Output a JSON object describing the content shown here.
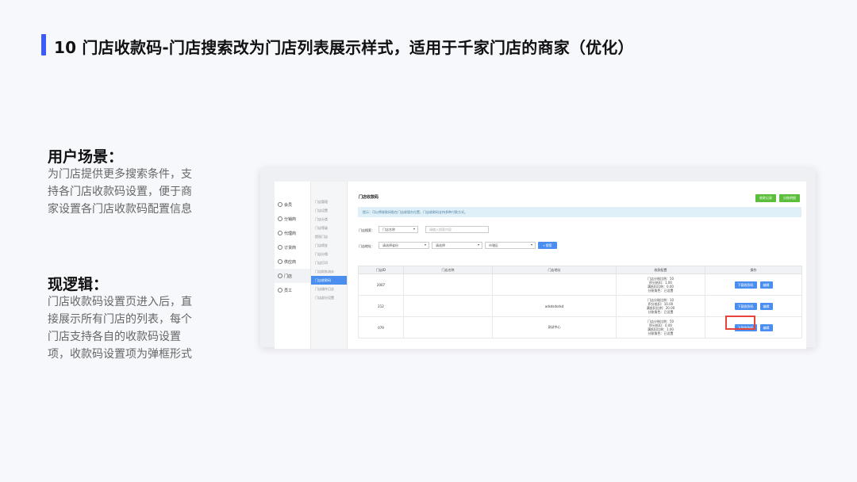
{
  "slide": {
    "title": "10 门店收款码-门店搜索改为门店列表展示样式，适用于千家门店的商家（优化）",
    "scene_heading": "用户场景：",
    "scene_body": "为门店提供更多搜索条件，支持各门店收款码设置，便于商家设置各门店收款码配置信息",
    "logic_heading": "现逻辑：",
    "logic_body": "门店收款码设置页进入后，直接展示所有门店的列表，每个门店支持各自的收款码设置项，收款码设置项为弹框形式",
    "accent_color": "#3d5cf5"
  },
  "mock": {
    "nav1": [
      {
        "label": "会员",
        "icon": "user-icon"
      },
      {
        "label": "分销商",
        "icon": "user-icon"
      },
      {
        "label": "代理商",
        "icon": "user-icon"
      },
      {
        "label": "订货商",
        "icon": "user-icon"
      },
      {
        "label": "供应商",
        "icon": "user-icon"
      },
      {
        "label": "门店",
        "icon": "store-icon",
        "active": true
      },
      {
        "label": "员工",
        "icon": "user-icon"
      }
    ],
    "nav2": [
      {
        "label": "门店管理"
      },
      {
        "label": "门店设置"
      },
      {
        "label": "门店分类"
      },
      {
        "label": "门店等级"
      },
      {
        "label": "提现门店"
      },
      {
        "label": "门店佣金"
      },
      {
        "label": "门店分佣"
      },
      {
        "label": "门店打印"
      },
      {
        "label": "门店财务流水"
      },
      {
        "label": "门店收款码",
        "active": true
      },
      {
        "label": "门店操作日志"
      },
      {
        "label": "门店部分设置"
      }
    ],
    "content_title": "门店收款码",
    "top_btn_1": "收款记录",
    "top_btn_2": "分账明细",
    "notice": "提示：可以将收款码贴在门店收银台位置，门店收款码支持多种付款方式。",
    "filter1_label": "门店搜索：",
    "filter1_select": "门店名称",
    "filter1_placeholder": "请输入搜索内容",
    "filter2_label": "门店地址：",
    "filter2_province": "请选择省份",
    "filter2_city": "请选择",
    "filter2_district": "市辖区",
    "search_btn": "搜索",
    "headers": [
      "门店ID",
      "门店名称",
      "门店地址",
      "收款配置",
      "操作"
    ],
    "rows": [
      {
        "id": "2007",
        "name": "",
        "address": "",
        "rules": [
          "门店分账比例：50",
          "积分抵扣：1.00",
          "满抵扣比例：0.00",
          "分账角色：已设置"
        ],
        "download": "下载收款码",
        "edit": "编辑"
      },
      {
        "id": "212",
        "name": "",
        "address": "adsdsdsdsd",
        "rules": [
          "门店分账比例：10",
          "积分抵扣：10.00",
          "满抵扣比例：20.00",
          "分账角色：已设置"
        ],
        "download": "下载收款码",
        "edit": "编辑"
      },
      {
        "id": "079",
        "name": "",
        "address": "测试中心",
        "rules": [
          "门店分账比例：50",
          "积分抵扣：0.00",
          "满抵扣比例：1.00",
          "分账角色：已设置"
        ],
        "download": "下载收款码",
        "edit": "编辑"
      }
    ],
    "highlight_color": "#e8443a"
  }
}
